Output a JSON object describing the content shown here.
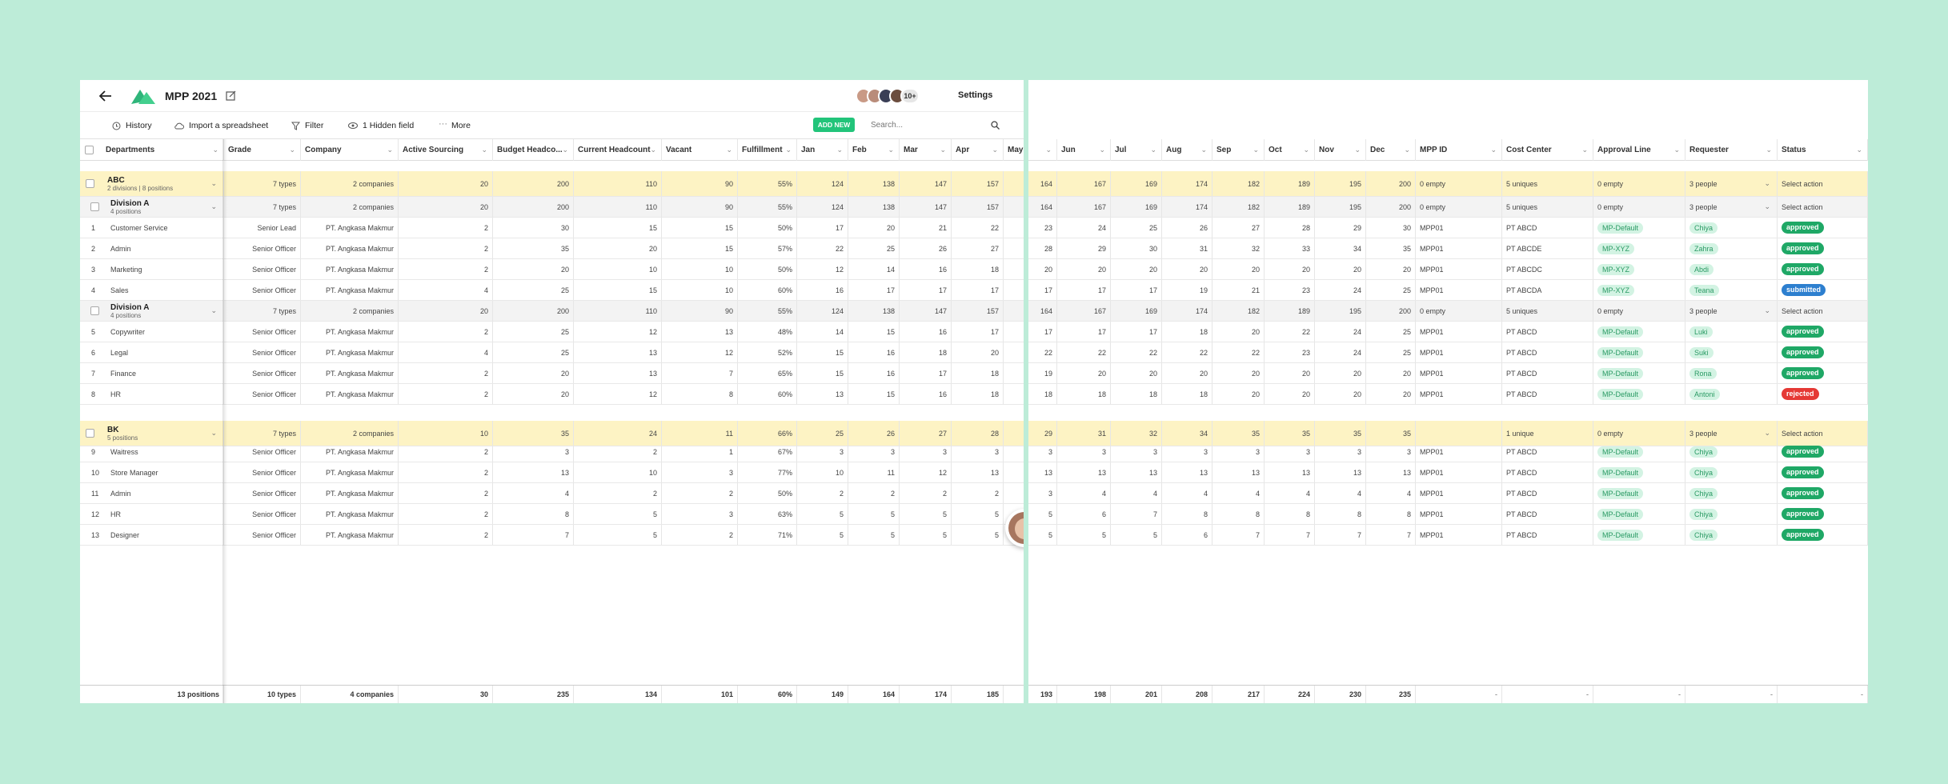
{
  "app": {
    "title": "MPP 2021",
    "settings_label": "Settings",
    "members_more": "10+"
  },
  "toolbar": {
    "history": "History",
    "import": "Import a spreadsheet",
    "filter": "Filter",
    "hidden": "1 Hidden field",
    "more": "More",
    "add_new": "ADD NEW",
    "search_placeholder": "Search..."
  },
  "colors": {
    "accent": "#22c47a",
    "group_bg": "#fdf3c4",
    "approved": "#1fa866",
    "submitted": "#2d7fcf",
    "rejected": "#e53935",
    "background": "#bdecd8"
  },
  "headers": {
    "departments": "Departments",
    "grade": "Grade",
    "company": "Company",
    "active": "Active Sourcing",
    "budget": "Budget Headco...",
    "current": "Current Headcount",
    "vacant": "Vacant",
    "fulfill": "Fulfillment",
    "jan": "Jan",
    "feb": "Feb",
    "mar": "Mar",
    "apr": "Apr",
    "may": "May",
    "jun": "Jun",
    "jul": "Jul",
    "aug": "Aug",
    "sep": "Sep",
    "oct": "Oct",
    "nov": "Nov",
    "dec": "Dec",
    "mppid": "MPP ID",
    "cost": "Cost Center",
    "approval": "Approval Line",
    "requester": "Requester",
    "status": "Status"
  },
  "rows": [
    {
      "kind": "group",
      "title": "ABC",
      "sub": "2 divisions | 8 positions",
      "grade": "7 types",
      "company": "2 companies",
      "active": "20",
      "budget": "200",
      "current": "110",
      "vacant": "90",
      "fulfill": "55%",
      "jan": "124",
      "feb": "138",
      "mar": "147",
      "apr": "157",
      "jun": "164",
      "jul": "167",
      "aug": "169",
      "sep": "174",
      "oct": "182",
      "nov": "189",
      "dec": "195",
      "dec2": "200",
      "mppid": "0 empty",
      "cost": "5 uniques",
      "approval": "0 empty",
      "requester": "3 people",
      "status": "Select action"
    },
    {
      "kind": "sub",
      "title": "Division A",
      "sub": "4 positions",
      "grade": "7 types",
      "company": "2 companies",
      "active": "20",
      "budget": "200",
      "current": "110",
      "vacant": "90",
      "fulfill": "55%",
      "jan": "124",
      "feb": "138",
      "mar": "147",
      "apr": "157",
      "jun": "164",
      "jul": "167",
      "aug": "169",
      "sep": "174",
      "oct": "182",
      "nov": "189",
      "dec": "195",
      "dec2": "200",
      "mppid": "0 empty",
      "cost": "5 uniques",
      "approval": "0 empty",
      "requester": "3 people",
      "status": "Select action"
    },
    {
      "kind": "item",
      "num": "1",
      "title": "Customer Service",
      "grade": "Senior Lead",
      "company": "PT. Angkasa Makmur",
      "active": "2",
      "budget": "30",
      "current": "15",
      "vacant": "15",
      "fulfill": "50%",
      "jan": "17",
      "feb": "20",
      "mar": "21",
      "apr": "22",
      "jun": "23",
      "jul": "24",
      "aug": "25",
      "sep": "26",
      "oct": "27",
      "nov": "28",
      "dec": "29",
      "dec2": "30",
      "mppid": "MPP01",
      "cost": "PT ABCD",
      "approval": "MP-Default",
      "requester": "Chiya",
      "status": "approved"
    },
    {
      "kind": "item",
      "num": "2",
      "title": "Admin",
      "grade": "Senior Officer",
      "company": "PT. Angkasa Makmur",
      "active": "2",
      "budget": "35",
      "current": "20",
      "vacant": "15",
      "fulfill": "57%",
      "jan": "22",
      "feb": "25",
      "mar": "26",
      "apr": "27",
      "jun": "28",
      "jul": "29",
      "aug": "30",
      "sep": "31",
      "oct": "32",
      "nov": "33",
      "dec": "34",
      "dec2": "35",
      "mppid": "MPP01",
      "cost": "PT ABCDE",
      "approval": "MP-XYZ",
      "requester": "Zahra",
      "status": "approved"
    },
    {
      "kind": "item",
      "num": "3",
      "title": "Marketing",
      "grade": "Senior Officer",
      "company": "PT. Angkasa Makmur",
      "active": "2",
      "budget": "20",
      "current": "10",
      "vacant": "10",
      "fulfill": "50%",
      "jan": "12",
      "feb": "14",
      "mar": "16",
      "apr": "18",
      "jun": "20",
      "jul": "20",
      "aug": "20",
      "sep": "20",
      "oct": "20",
      "nov": "20",
      "dec": "20",
      "dec2": "20",
      "mppid": "MPP01",
      "cost": "PT ABCDC",
      "approval": "MP-XYZ",
      "requester": "Abdi",
      "status": "approved"
    },
    {
      "kind": "item",
      "num": "4",
      "title": "Sales",
      "grade": "Senior Officer",
      "company": "PT. Angkasa Makmur",
      "active": "4",
      "budget": "25",
      "current": "15",
      "vacant": "10",
      "fulfill": "60%",
      "jan": "16",
      "feb": "17",
      "mar": "17",
      "apr": "17",
      "jun": "17",
      "jul": "17",
      "aug": "17",
      "sep": "19",
      "oct": "21",
      "nov": "23",
      "dec": "24",
      "dec2": "25",
      "mppid": "MPP01",
      "cost": "PT ABCDA",
      "approval": "MP-XYZ",
      "requester": "Teana",
      "status": "submitted"
    },
    {
      "kind": "sub",
      "title": "Division A",
      "sub": "4 positions",
      "grade": "7 types",
      "company": "2 companies",
      "active": "20",
      "budget": "200",
      "current": "110",
      "vacant": "90",
      "fulfill": "55%",
      "jan": "124",
      "feb": "138",
      "mar": "147",
      "apr": "157",
      "jun": "164",
      "jul": "167",
      "aug": "169",
      "sep": "174",
      "oct": "182",
      "nov": "189",
      "dec": "195",
      "dec2": "200",
      "mppid": "0 empty",
      "cost": "5 uniques",
      "approval": "0 empty",
      "requester": "3 people",
      "status": "Select action"
    },
    {
      "kind": "item",
      "num": "5",
      "title": "Copywriter",
      "grade": "Senior Officer",
      "company": "PT. Angkasa Makmur",
      "active": "2",
      "budget": "25",
      "current": "12",
      "vacant": "13",
      "fulfill": "48%",
      "jan": "14",
      "feb": "15",
      "mar": "16",
      "apr": "17",
      "jun": "17",
      "jul": "17",
      "aug": "17",
      "sep": "18",
      "oct": "20",
      "nov": "22",
      "dec": "24",
      "dec2": "25",
      "mppid": "MPP01",
      "cost": "PT ABCD",
      "approval": "MP-Default",
      "requester": "Luki",
      "status": "approved"
    },
    {
      "kind": "item",
      "num": "6",
      "title": "Legal",
      "grade": "Senior Officer",
      "company": "PT. Angkasa Makmur",
      "active": "4",
      "budget": "25",
      "current": "13",
      "vacant": "12",
      "fulfill": "52%",
      "jan": "15",
      "feb": "16",
      "mar": "18",
      "apr": "20",
      "jun": "22",
      "jul": "22",
      "aug": "22",
      "sep": "22",
      "oct": "22",
      "nov": "23",
      "dec": "24",
      "dec2": "25",
      "mppid": "MPP01",
      "cost": "PT ABCD",
      "approval": "MP-Default",
      "requester": "Suki",
      "status": "approved"
    },
    {
      "kind": "item",
      "num": "7",
      "title": "Finance",
      "grade": "Senior Officer",
      "company": "PT. Angkasa Makmur",
      "active": "2",
      "budget": "20",
      "current": "13",
      "vacant": "7",
      "fulfill": "65%",
      "jan": "15",
      "feb": "16",
      "mar": "17",
      "apr": "18",
      "jun": "19",
      "jul": "20",
      "aug": "20",
      "sep": "20",
      "oct": "20",
      "nov": "20",
      "dec": "20",
      "dec2": "20",
      "mppid": "MPP01",
      "cost": "PT ABCD",
      "approval": "MP-Default",
      "requester": "Rona",
      "status": "approved"
    },
    {
      "kind": "item",
      "num": "8",
      "title": "HR",
      "grade": "Senior Officer",
      "company": "PT. Angkasa Makmur",
      "active": "2",
      "budget": "20",
      "current": "12",
      "vacant": "8",
      "fulfill": "60%",
      "jan": "13",
      "feb": "15",
      "mar": "16",
      "apr": "18",
      "jun": "18",
      "jul": "18",
      "aug": "18",
      "sep": "18",
      "oct": "20",
      "nov": "20",
      "dec": "20",
      "dec2": "20",
      "mppid": "MPP01",
      "cost": "PT ABCD",
      "approval": "MP-Default",
      "requester": "Antoni",
      "status": "rejected"
    },
    {
      "kind": "group",
      "title": "BK",
      "sub": "5 positions",
      "grade": "7 types",
      "company": "2 companies",
      "active": "10",
      "budget": "35",
      "current": "24",
      "vacant": "11",
      "fulfill": "66%",
      "jan": "25",
      "feb": "26",
      "mar": "27",
      "apr": "28",
      "jun": "29",
      "jul": "31",
      "aug": "32",
      "sep": "34",
      "oct": "35",
      "nov": "35",
      "dec": "35",
      "dec2": "35",
      "mppid": "",
      "cost": "1 unique",
      "approval": "0 empty",
      "requester": "3 people",
      "status": "Select action"
    },
    {
      "kind": "item",
      "num": "9",
      "title": "Waitress",
      "grade": "Senior Officer",
      "company": "PT. Angkasa Makmur",
      "active": "2",
      "budget": "3",
      "current": "2",
      "vacant": "1",
      "fulfill": "67%",
      "jan": "3",
      "feb": "3",
      "mar": "3",
      "apr": "3",
      "jun": "3",
      "jul": "3",
      "aug": "3",
      "sep": "3",
      "oct": "3",
      "nov": "3",
      "dec": "3",
      "dec2": "3",
      "mppid": "MPP01",
      "cost": "PT ABCD",
      "approval": "MP-Default",
      "requester": "Chiya",
      "status": "approved"
    },
    {
      "kind": "item",
      "num": "10",
      "title": "Store Manager",
      "grade": "Senior Officer",
      "company": "PT. Angkasa Makmur",
      "active": "2",
      "budget": "13",
      "current": "10",
      "vacant": "3",
      "fulfill": "77%",
      "jan": "10",
      "feb": "11",
      "mar": "12",
      "apr": "13",
      "jun": "13",
      "jul": "13",
      "aug": "13",
      "sep": "13",
      "oct": "13",
      "nov": "13",
      "dec": "13",
      "dec2": "13",
      "mppid": "MPP01",
      "cost": "PT ABCD",
      "approval": "MP-Default",
      "requester": "Chiya",
      "status": "approved"
    },
    {
      "kind": "item",
      "num": "11",
      "title": "Admin",
      "grade": "Senior Officer",
      "company": "PT. Angkasa Makmur",
      "active": "2",
      "budget": "4",
      "current": "2",
      "vacant": "2",
      "fulfill": "50%",
      "jan": "2",
      "feb": "2",
      "mar": "2",
      "apr": "2",
      "jun": "3",
      "jul": "4",
      "aug": "4",
      "sep": "4",
      "oct": "4",
      "nov": "4",
      "dec": "4",
      "dec2": "4",
      "mppid": "MPP01",
      "cost": "PT ABCD",
      "approval": "MP-Default",
      "requester": "Chiya",
      "status": "approved"
    },
    {
      "kind": "item",
      "num": "12",
      "title": "HR",
      "grade": "Senior Officer",
      "company": "PT. Angkasa Makmur",
      "active": "2",
      "budget": "8",
      "current": "5",
      "vacant": "3",
      "fulfill": "63%",
      "jan": "5",
      "feb": "5",
      "mar": "5",
      "apr": "5",
      "jun": "5",
      "jul": "6",
      "aug": "7",
      "sep": "8",
      "oct": "8",
      "nov": "8",
      "dec": "8",
      "dec2": "8",
      "mppid": "MPP01",
      "cost": "PT ABCD",
      "approval": "MP-Default",
      "requester": "Chiya",
      "status": "approved"
    },
    {
      "kind": "item",
      "num": "13",
      "title": "Designer",
      "grade": "Senior Officer",
      "company": "PT. Angkasa Makmur",
      "active": "2",
      "budget": "7",
      "current": "5",
      "vacant": "2",
      "fulfill": "71%",
      "jan": "5",
      "feb": "5",
      "mar": "5",
      "apr": "5",
      "jun": "5",
      "jul": "5",
      "aug": "5",
      "sep": "6",
      "oct": "7",
      "nov": "7",
      "dec": "7",
      "dec2": "7",
      "mppid": "MPP01",
      "cost": "PT ABCD",
      "approval": "MP-Default",
      "requester": "Chiya",
      "status": "approved"
    }
  ],
  "footer": {
    "positions": "13 positions",
    "grade": "10 types",
    "company": "4 companies",
    "active": "30",
    "budget": "235",
    "current": "134",
    "vacant": "101",
    "fulfill": "60%",
    "jan": "149",
    "feb": "164",
    "mar": "174",
    "apr": "185",
    "jun": "193",
    "jul": "198",
    "aug": "201",
    "sep": "208",
    "oct": "217",
    "nov": "224",
    "dec": "230",
    "dec2": "235",
    "dash": "-"
  }
}
